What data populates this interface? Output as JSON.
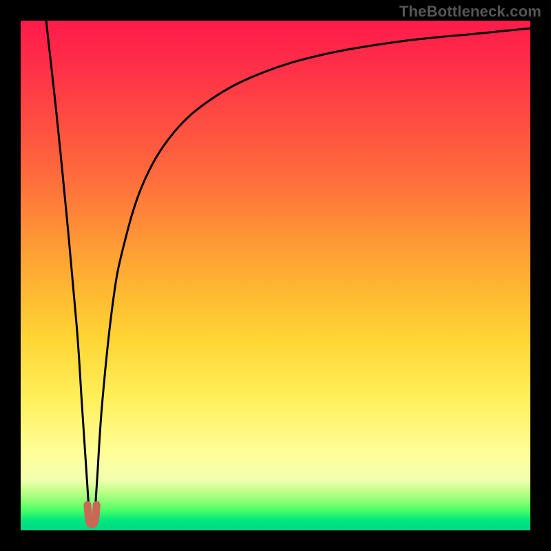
{
  "watermark": "TheBottleneck.com",
  "chart_data": {
    "type": "line",
    "title": "",
    "xlabel": "",
    "ylabel": "",
    "xlim": [
      0,
      100
    ],
    "ylim": [
      0,
      100
    ],
    "grid": false,
    "legend": false,
    "series": [
      {
        "name": "bottleneck-curve",
        "x": [
          5,
          7,
          9,
          11,
          12,
          13,
          13.5,
          14,
          14.5,
          15,
          16,
          18,
          20,
          24,
          30,
          38,
          48,
          60,
          75,
          90,
          100
        ],
        "y": [
          100,
          82,
          62,
          40,
          25,
          10,
          3,
          1.5,
          3,
          10,
          25,
          44,
          55,
          68,
          78,
          85,
          90,
          93.5,
          96,
          97.5,
          98.5
        ]
      },
      {
        "name": "trough-marker",
        "x": [
          13.1,
          13.3,
          13.6,
          14.0,
          14.4,
          14.7,
          14.9
        ],
        "y": [
          5.0,
          2.6,
          1.4,
          1.2,
          1.4,
          2.6,
          5.0
        ]
      }
    ],
    "colors": {
      "curve": "#000000",
      "marker": "#cc6655",
      "background_top": "#ff1a4a",
      "background_bottom": "#00d887"
    }
  }
}
